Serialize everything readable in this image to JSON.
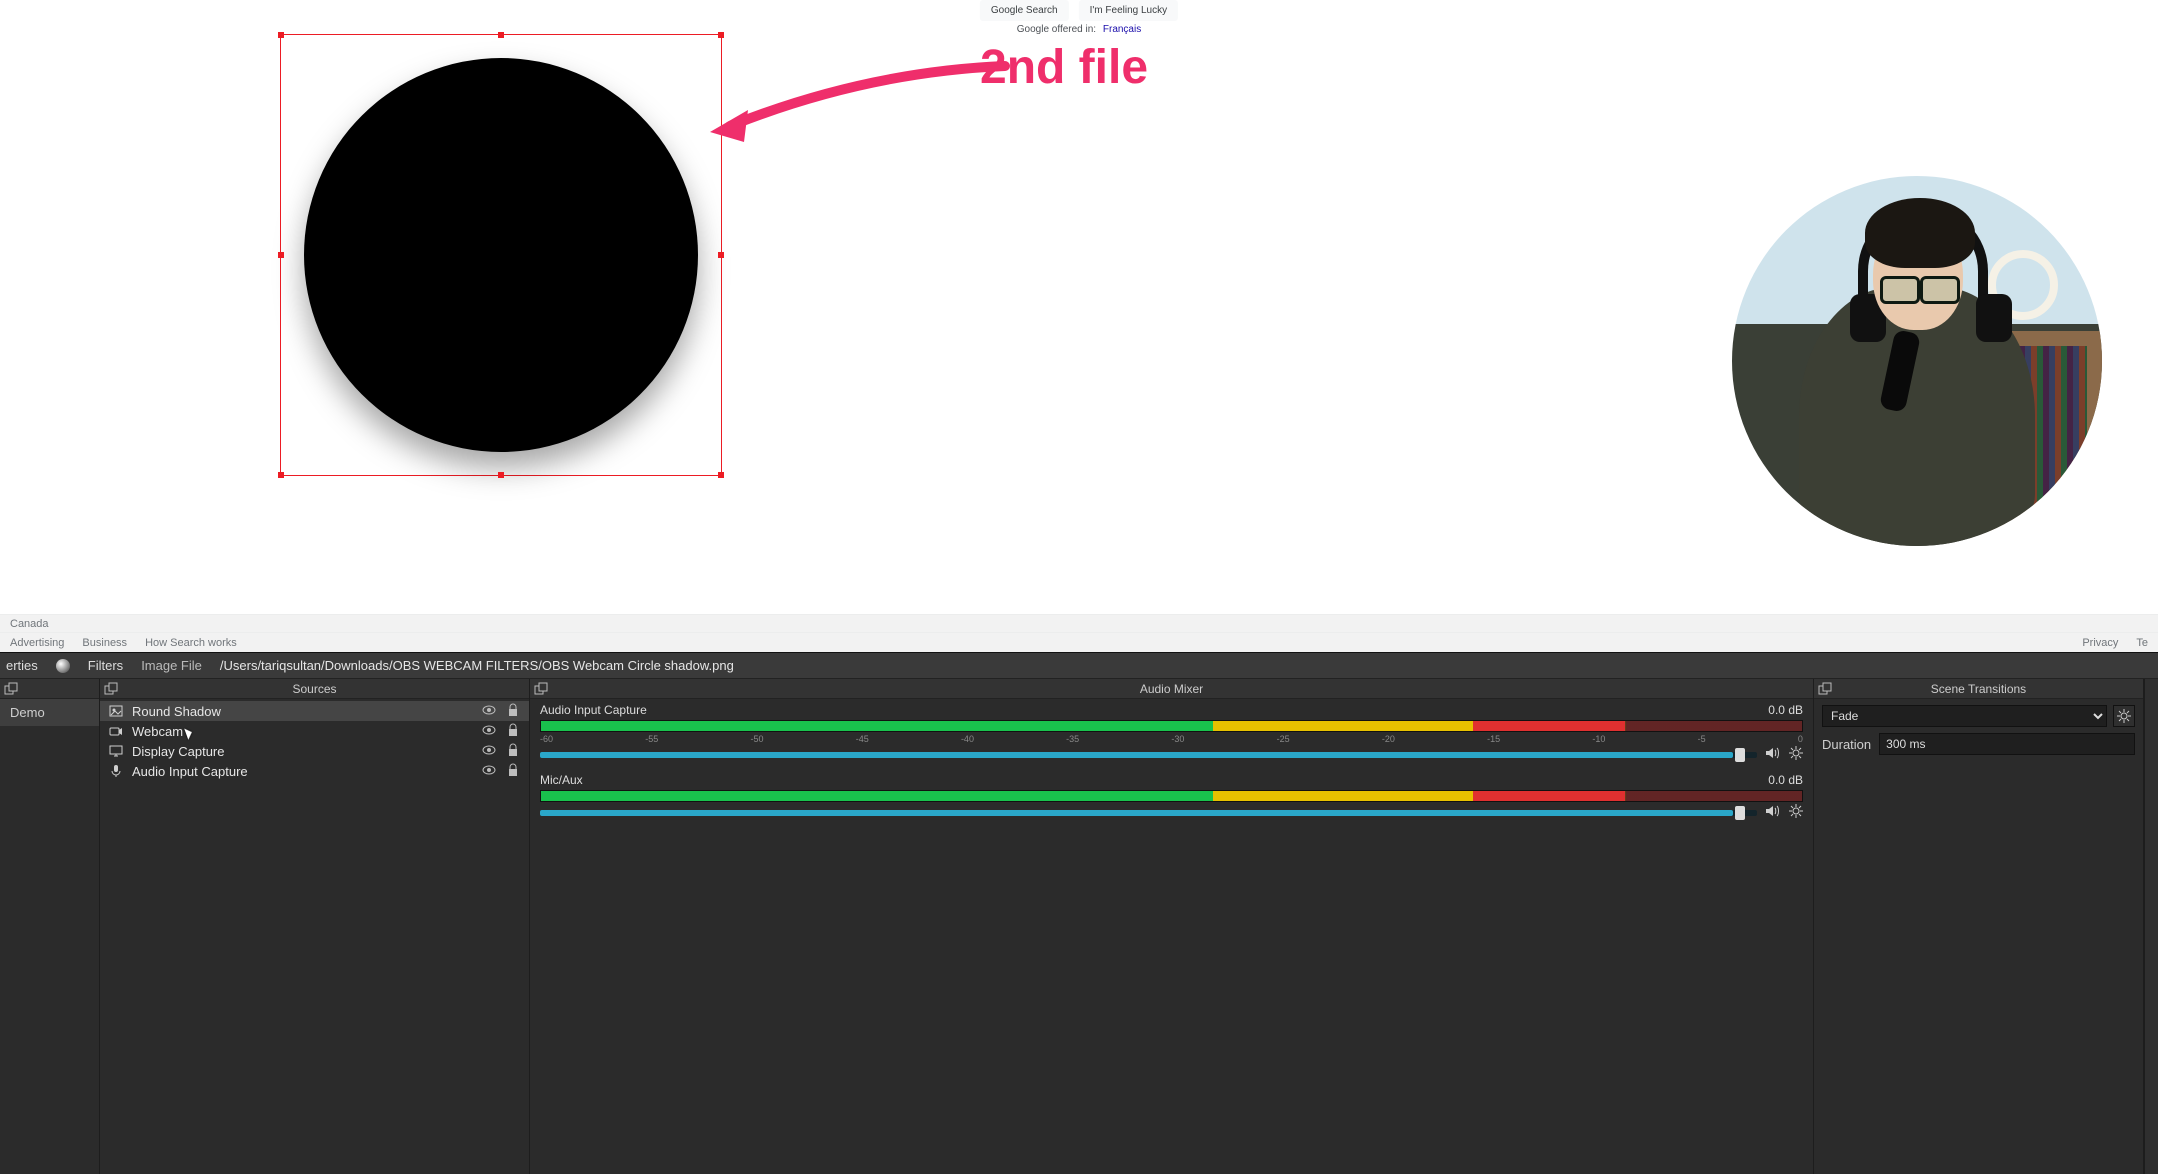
{
  "google": {
    "search_btn": "Google Search",
    "lucky_btn": "I'm Feeling Lucky",
    "offered_in": "Google offered in:",
    "offered_lang": "Français",
    "country": "Canada",
    "footer_links": [
      "Advertising",
      "Business",
      "How Search works"
    ],
    "footer_right": [
      "Privacy",
      "Te"
    ]
  },
  "annotation": {
    "label": "2nd file"
  },
  "obs": {
    "topbar": {
      "properties_tab": "erties",
      "filters_tab": "Filters",
      "image_file_label": "Image File",
      "image_file_path": "/Users/tariqsultan/Downloads/OBS WEBCAM FILTERS/OBS Webcam Circle shadow.png"
    },
    "scenes": {
      "title_hidden": "",
      "items": [
        "Demo"
      ]
    },
    "sources": {
      "title": "Sources",
      "items": [
        {
          "name": "Round Shadow",
          "selected": true,
          "icon": "image"
        },
        {
          "name": "Webcam",
          "selected": false,
          "icon": "camera",
          "cursor": true
        },
        {
          "name": "Display Capture",
          "selected": false,
          "icon": "display"
        },
        {
          "name": "Audio Input Capture",
          "selected": false,
          "icon": "mic"
        }
      ]
    },
    "mixer": {
      "title": "Audio Mixer",
      "ticks": [
        "-60",
        "-55",
        "-50",
        "-45",
        "-40",
        "-35",
        "-30",
        "-25",
        "-20",
        "-15",
        "-10",
        "-5",
        "0"
      ],
      "channels": [
        {
          "name": "Audio Input Capture",
          "db": "0.0 dB"
        },
        {
          "name": "Mic/Aux",
          "db": "0.0 dB"
        }
      ]
    },
    "transitions": {
      "title": "Scene Transitions",
      "selected": "Fade",
      "duration_label": "Duration",
      "duration_value": "300 ms"
    }
  }
}
